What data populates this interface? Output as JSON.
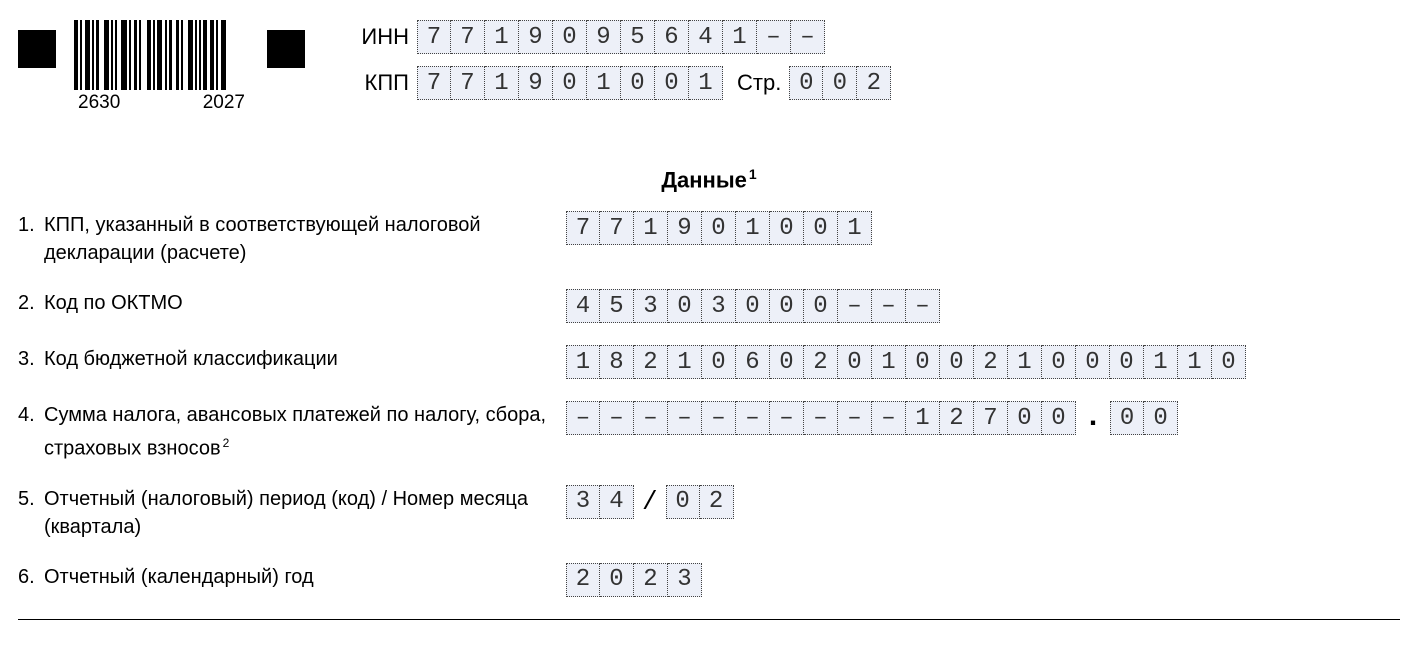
{
  "barcode": {
    "left_num": "2630",
    "right_num": "2027"
  },
  "header": {
    "inn_label": "ИНН",
    "inn_value": "7719095641––",
    "kpp_label": "КПП",
    "kpp_value": "771901001",
    "page_label": "Стр.",
    "page_value": "002"
  },
  "section_title": "Данные",
  "section_title_sup": "1",
  "rows": [
    {
      "num": "1.",
      "label": "КПП, указанный в соответствующей налоговой декларации (расчете)",
      "cells": [
        "771901001"
      ]
    },
    {
      "num": "2.",
      "label": "Код по ОКТМО",
      "cells": [
        "45303000–––"
      ]
    },
    {
      "num": "3.",
      "label": "Код бюджетной классификации",
      "cells": [
        "18210602010021000110"
      ]
    },
    {
      "num": "4.",
      "label": "Сумма налога, авансовых платежей по налогу, сбора, страховых взносов",
      "label_sup": "2",
      "cells": [
        "––––––––––12700",
        "00"
      ],
      "sep": "."
    },
    {
      "num": "5.",
      "label": "Отчетный (налоговый) период (код) / Номер месяца (квартала)",
      "cells": [
        "34",
        "02"
      ],
      "sep": "/"
    },
    {
      "num": "6.",
      "label": "Отчетный (календарный) год",
      "cells": [
        "2023"
      ]
    }
  ]
}
